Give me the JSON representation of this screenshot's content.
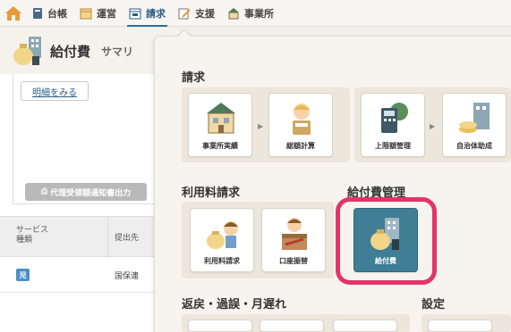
{
  "nav": {
    "items": [
      {
        "label": "台帳",
        "icon": "ledger-icon"
      },
      {
        "label": "運営",
        "icon": "calendar-icon"
      },
      {
        "label": "請求",
        "icon": "billing-icon",
        "active": true
      },
      {
        "label": "支援",
        "icon": "support-icon"
      },
      {
        "label": "事業所",
        "icon": "office-icon"
      }
    ]
  },
  "left": {
    "title": "給付費",
    "tab": "サマリ",
    "detail_button": "明細をみる",
    "proxy_button": "代理受領額通知書出力",
    "table": {
      "col1": "サービス種類",
      "col1_line1": "サービス",
      "col1_line2": "種類",
      "col2": "提出先",
      "rows": [
        {
          "badge": "児",
          "submit_to": "国保連"
        }
      ]
    }
  },
  "menu": {
    "sections": {
      "billing": "請求",
      "usage_fee": "利用料請求",
      "benefit_mgmt": "給付費管理",
      "returns": "返戻・過誤・月遅れ",
      "settings": "設定"
    },
    "tiles": {
      "office_record": "事業所実績",
      "total_calc": "総額計算",
      "limit_mgmt": "上限額管理",
      "local_subsidy": "自治体助成",
      "usage_billing": "利用料請求",
      "account_transfer": "口座振替",
      "benefit": "給付費"
    }
  },
  "colors": {
    "accent": "#2a6f9e",
    "highlight": "#e2346b",
    "selected_tile": "#3f7e94"
  }
}
